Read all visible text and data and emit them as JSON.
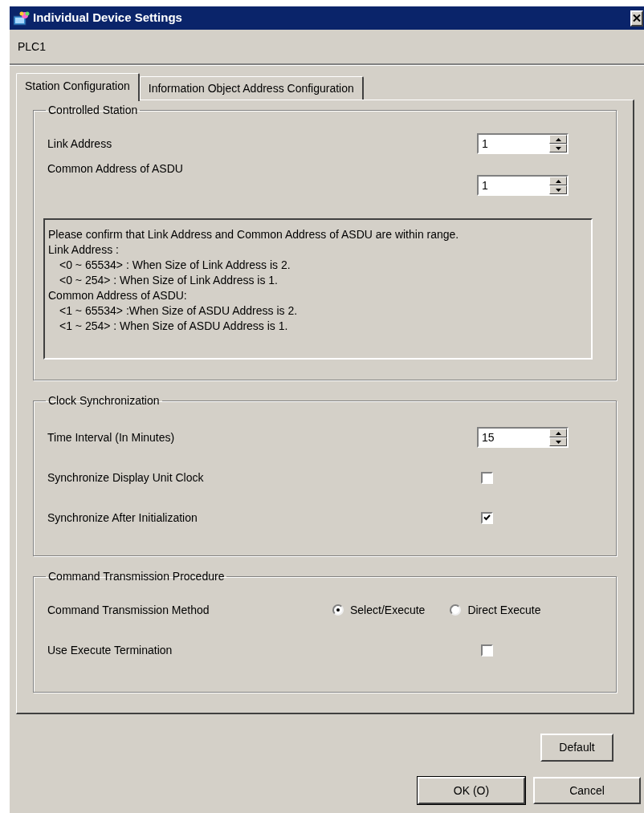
{
  "window": {
    "title": "Individual Device Settings"
  },
  "device": "PLC1",
  "tabs": [
    {
      "label": "Station Configuration",
      "selected": true
    },
    {
      "label": "Information Object Address Configuration",
      "selected": false
    }
  ],
  "controlled_station": {
    "title": "Controlled Station",
    "fields": [
      {
        "label": "Link Address",
        "value": "1"
      },
      {
        "label": "Common Address of ASDU",
        "value": "1"
      }
    ],
    "info": [
      {
        "text": "Please confirm that Link Address and Common Address of ASDU are within range."
      },
      {
        "text": "Link Address :",
        "children": [
          {
            "text": "<0 ~ 65534> : When Size of Link Address is 2."
          },
          {
            "text": "<0 ~ 254> : When Size of Link Address is 1."
          }
        ]
      },
      {
        "text": "Common Address of ASDU:",
        "children": [
          {
            "text": "<1 ~ 65534> :When Size of ASDU Address is 2."
          },
          {
            "text": "<1 ~ 254> : When Size of ASDU Address is 1."
          }
        ]
      }
    ]
  },
  "clock_synchronization": {
    "title": "Clock Synchronization",
    "rows": [
      {
        "kind": "spin",
        "label": "Time Interval (In Minutes)",
        "value": "15"
      },
      {
        "kind": "checkbox",
        "label": "Synchronize Display Unit Clock",
        "checked": false
      },
      {
        "kind": "checkbox",
        "label": "Synchronize After Initialization",
        "checked": true
      }
    ]
  },
  "command_transmission": {
    "title": "Command Transmission Procedure",
    "rows": [
      {
        "kind": "radio",
        "label": "Command Transmission Method",
        "options": [
          {
            "label": "Select/Execute",
            "selected": true
          },
          {
            "label": "Direct Execute",
            "selected": false
          }
        ]
      },
      {
        "kind": "checkbox",
        "label": "Use Execute Termination",
        "checked": false
      }
    ]
  },
  "buttons": [
    {
      "label": "Default",
      "default": false
    },
    {
      "label": "OK (O)",
      "default": true
    },
    {
      "label": "Cancel",
      "default": false
    }
  ]
}
